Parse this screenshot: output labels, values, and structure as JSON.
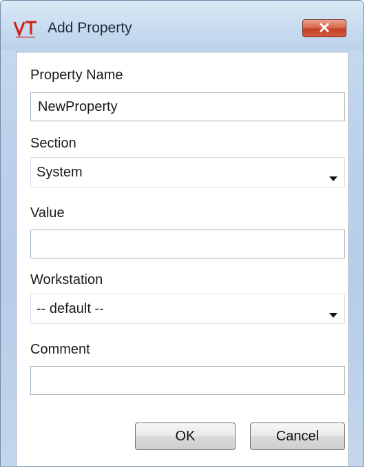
{
  "window": {
    "title": "Add Property",
    "app_icon": "vt-logo-icon",
    "close_icon": "close-icon"
  },
  "form": {
    "property_name_label": "Property Name",
    "property_name_value": "NewProperty",
    "section_label": "Section",
    "section_value": "System",
    "value_label": "Value",
    "value_value": "",
    "workstation_label": "Workstation",
    "workstation_value": "-- default --",
    "comment_label": "Comment",
    "comment_value": ""
  },
  "buttons": {
    "ok_label": "OK",
    "cancel_label": "Cancel"
  },
  "colors": {
    "close_button": "#c4412a",
    "window_frame": "#bcd2ea",
    "logo_red": "#d0231c"
  }
}
